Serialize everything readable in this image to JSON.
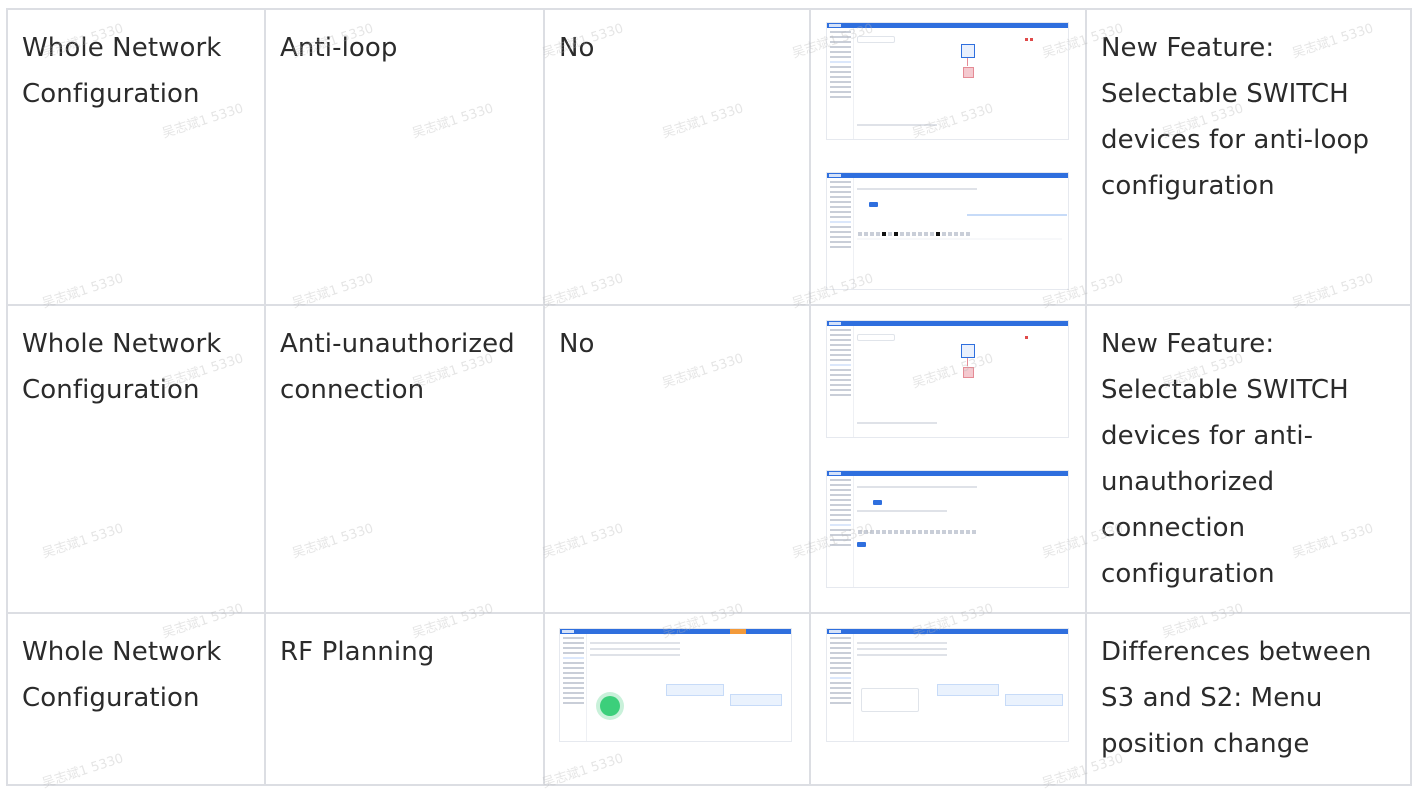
{
  "rows": [
    {
      "category": "Whole Network Configuration",
      "feature": "Anti-loop",
      "value": "No",
      "remark": "New Feature: Selectable SWITCH devices for anti-loop configuration"
    },
    {
      "category": "Whole Network Configuration",
      "feature": "Anti-unauthorized connection",
      "value": "No",
      "remark": "New Feature: Selectable SWITCH devices for anti-unauthorized connection configuration"
    },
    {
      "category": "Whole Network Configuration",
      "feature": "RF Planning",
      "value": "",
      "remark": "Differences between S3 and S2: Menu position change"
    }
  ],
  "watermark": "吴志斌1 5330"
}
